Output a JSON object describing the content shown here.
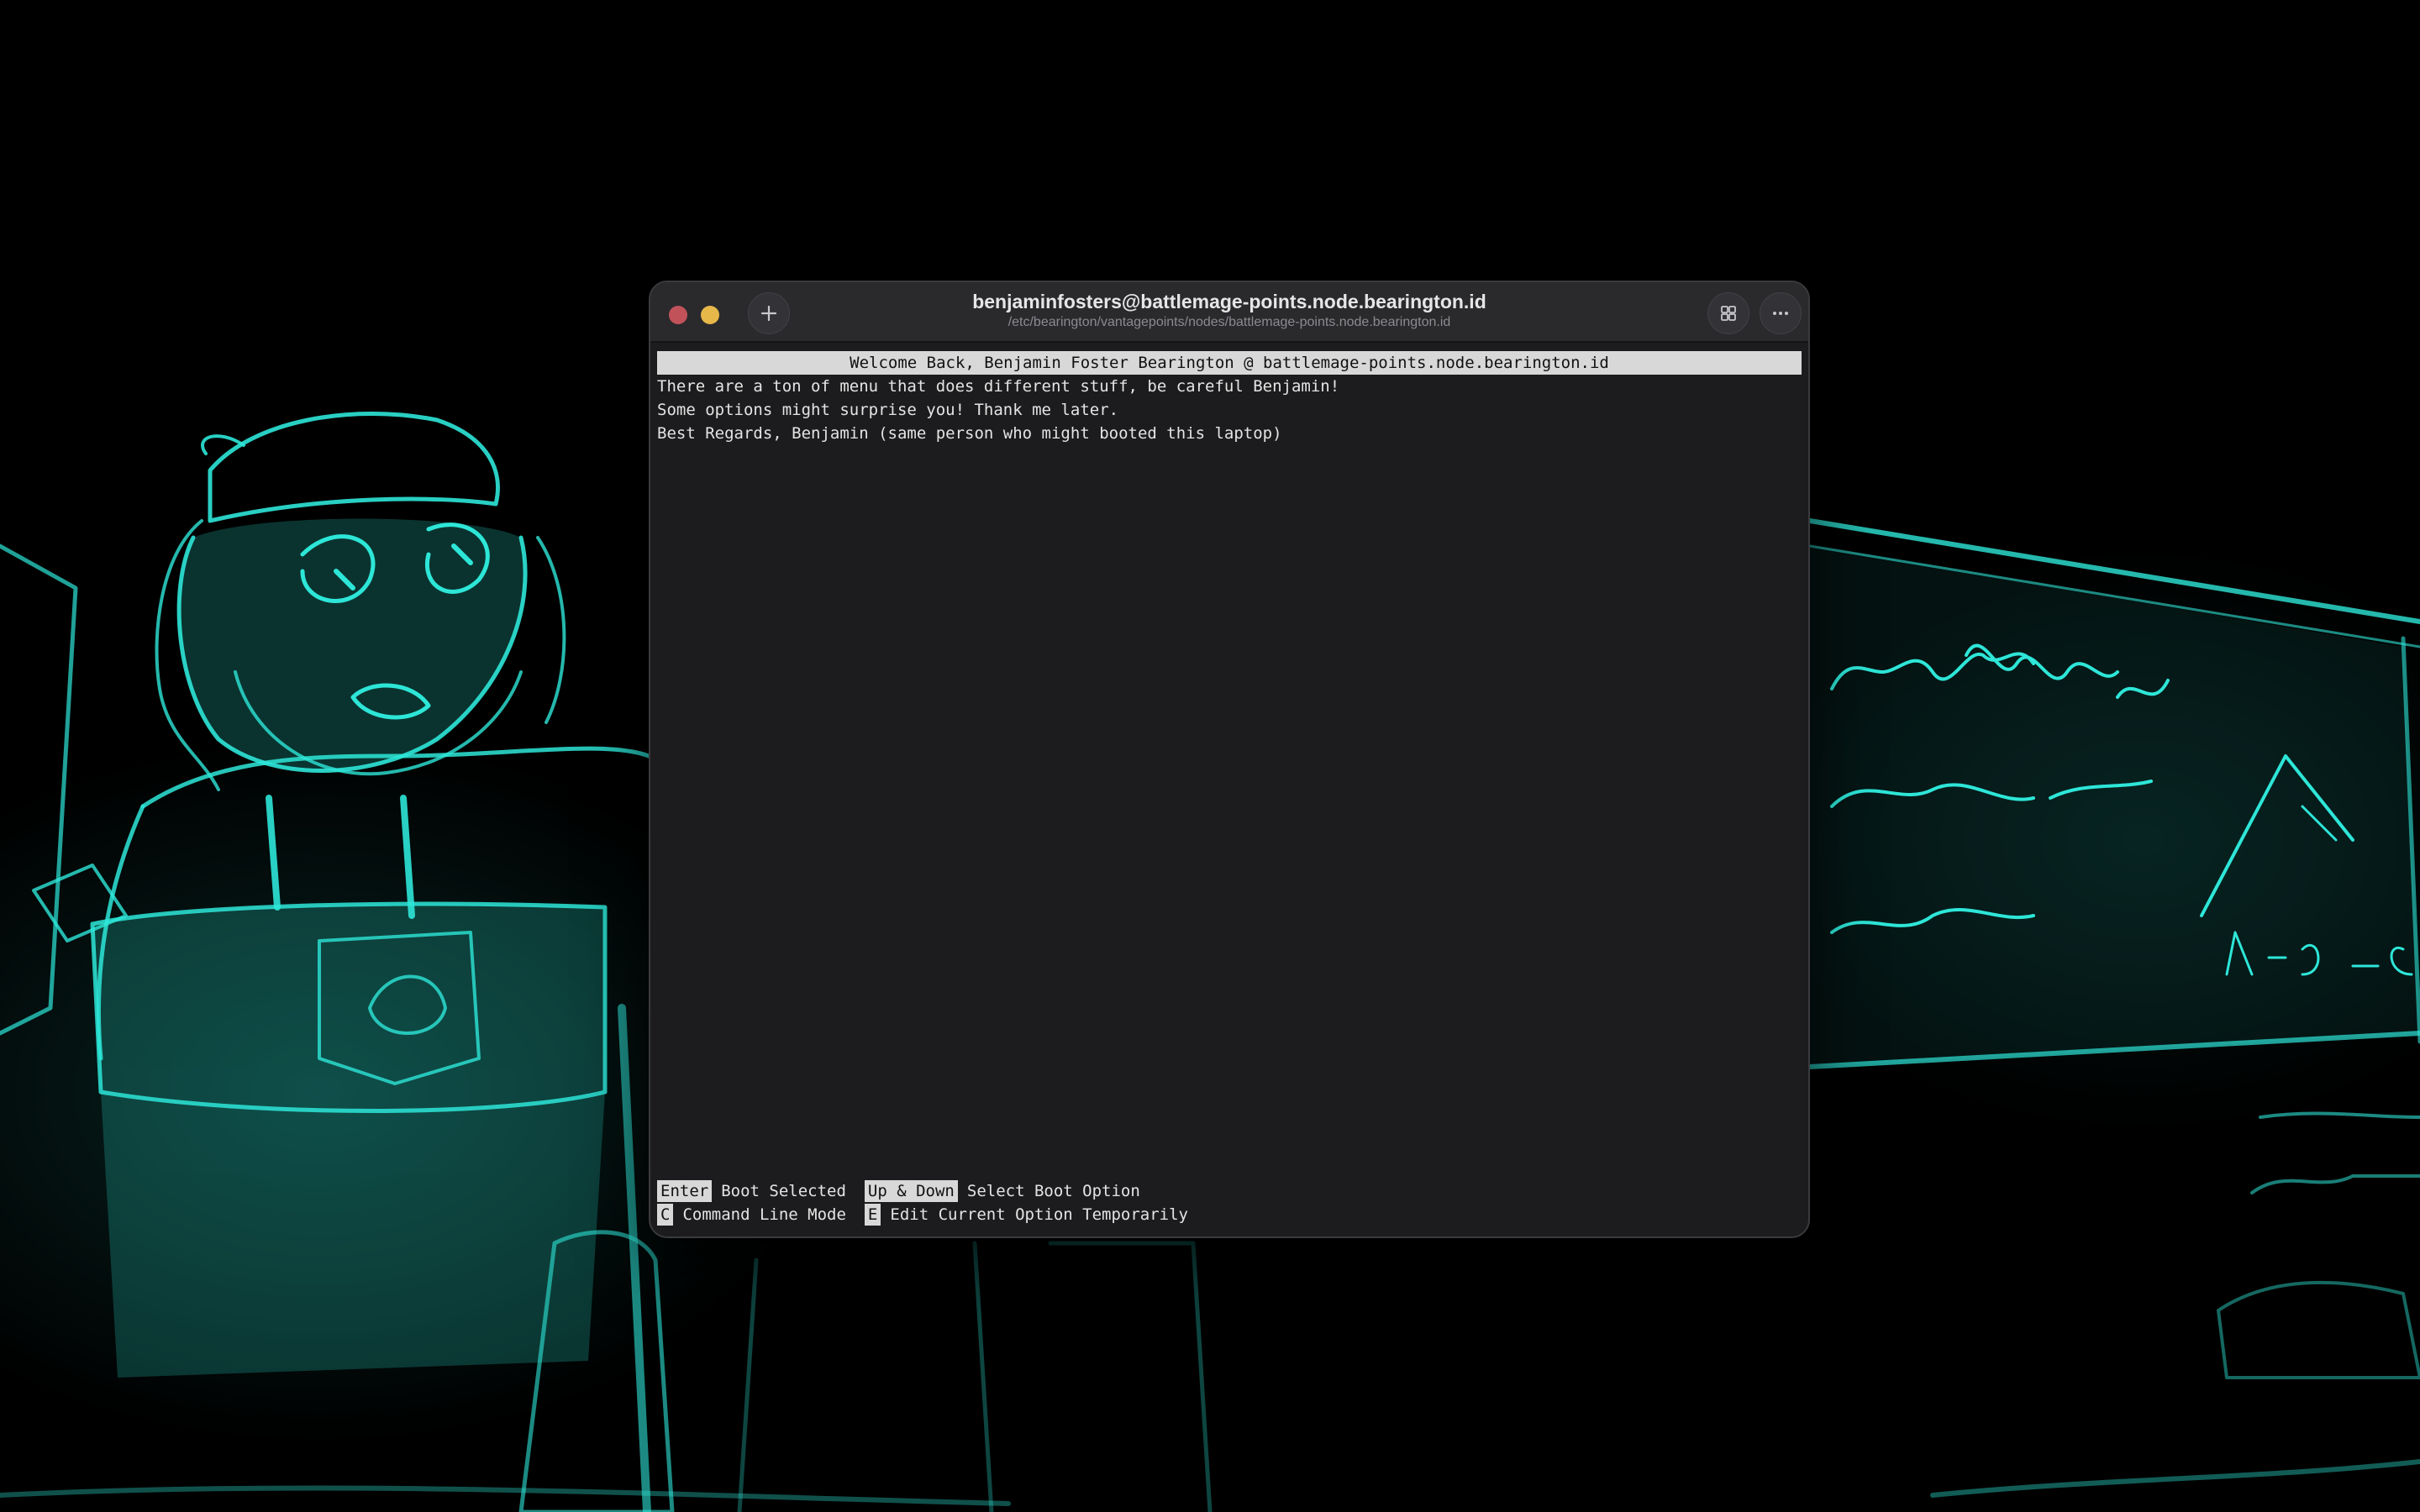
{
  "window": {
    "title": "benjaminfosters@battlemage-points.node.bearington.id",
    "subtitle": "/etc/bearington/vantagepoints/nodes/battlemage-points.node.bearington.id",
    "new_tab_icon": "plus-icon",
    "layout_icon": "grid-icon",
    "more_icon": "ellipsis-icon"
  },
  "terminal": {
    "header": "Welcome Back, Benjamin Foster Bearington @ battlemage-points.node.bearington.id",
    "lines": [
      "There are a ton of menu that does different stuff, be careful Benjamin!",
      "Some options might surprise you! Thank me later.",
      "Best Regards, Benjamin (same person who might booted this laptop)"
    ],
    "hints": [
      [
        {
          "key": "Enter",
          "label": "Boot Selected"
        },
        {
          "key": "Up & Down",
          "label": "Select Boot Option"
        }
      ],
      [
        {
          "key": "C",
          "label": "Command Line Mode"
        },
        {
          "key": "E",
          "label": "Edit Current Option Temporarily"
        }
      ]
    ]
  },
  "colors": {
    "background": "#000000",
    "illustration": "#2ee6d8",
    "window": "#1c1c1e",
    "titlebar": "#2a2a2d",
    "close": "#c1525a",
    "minimize": "#e6b84a",
    "highlight": "#d8d8d8"
  }
}
